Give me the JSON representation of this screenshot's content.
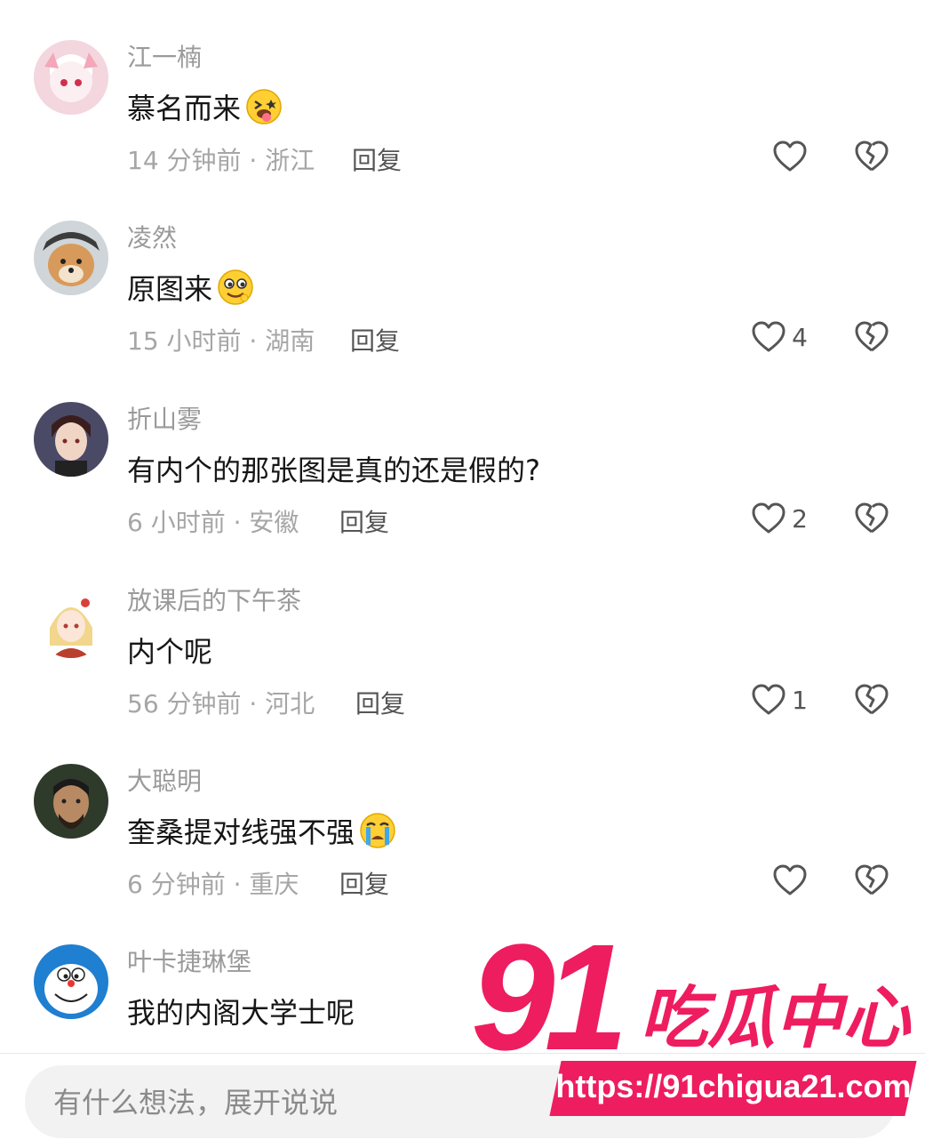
{
  "comments": [
    {
      "username": "江一楠",
      "text": "慕名而来",
      "emoji": "tongue-out-emoji",
      "time": "14 分钟前 · 浙江",
      "reply": "回复",
      "likes": ""
    },
    {
      "username": "凌然",
      "text": "原图来",
      "emoji": "drooling-emoji",
      "time": "15 小时前 · 湖南",
      "reply": "回复",
      "likes": "4"
    },
    {
      "username": "折山雾",
      "text": "有内个的那张图是真的还是假的?",
      "emoji": "",
      "time": "6 小时前 · 安徽",
      "reply": "回复",
      "likes": "2"
    },
    {
      "username": "放课后的下午茶",
      "text": "内个呢",
      "emoji": "",
      "time": "56 分钟前 · 河北",
      "reply": "回复",
      "likes": "1"
    },
    {
      "username": "大聪明",
      "text": "奎桑提对线强不强",
      "emoji": "crying-emoji",
      "time": "6 分钟前 · 重庆",
      "reply": "回复",
      "likes": ""
    },
    {
      "username": "叶卡捷琳堡",
      "text": "我的内阁大学士呢",
      "emoji": "",
      "time": "",
      "reply": "",
      "likes": ""
    }
  ],
  "input": {
    "placeholder": "有什么想法，展开说说"
  },
  "watermark": {
    "number": "91",
    "name": "吃瓜中心",
    "url": "https://91chigua21.com"
  },
  "colors": {
    "accent": "#ee1d5f",
    "text": "#161616",
    "muted": "#a6a6a6"
  }
}
